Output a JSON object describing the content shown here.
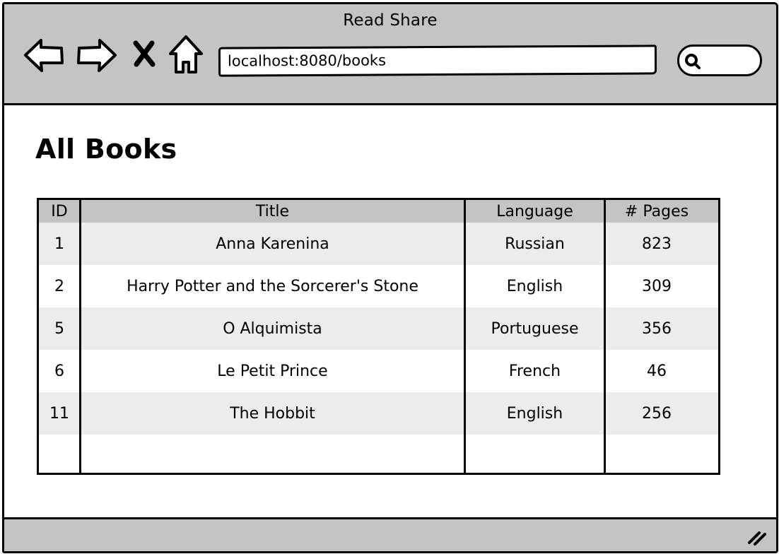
{
  "window": {
    "title": "Read Share"
  },
  "toolbar": {
    "icons": [
      "back-arrow-icon",
      "forward-arrow-icon",
      "close-x-icon",
      "home-icon"
    ],
    "url": "localhost:8080/books",
    "search_icon": "search-icon"
  },
  "page": {
    "title": "All Books"
  },
  "table": {
    "headers": [
      "ID",
      "Title",
      "Language",
      "# Pages"
    ],
    "rows": [
      {
        "id": "1",
        "title": "Anna Karenina",
        "language": "Russian",
        "pages": "823"
      },
      {
        "id": "2",
        "title": "Harry Potter and the Sorcerer's Stone",
        "language": "English",
        "pages": "309"
      },
      {
        "id": "5",
        "title": "O Alquimista",
        "language": "Portuguese",
        "pages": "356"
      },
      {
        "id": "6",
        "title": "Le Petit Prince",
        "language": "French",
        "pages": "46"
      },
      {
        "id": "11",
        "title": "The Hobbit",
        "language": "English",
        "pages": "256"
      }
    ]
  },
  "colors": {
    "chrome": "#c4c4c4",
    "row_alt": "#ececec",
    "border": "#000000"
  }
}
